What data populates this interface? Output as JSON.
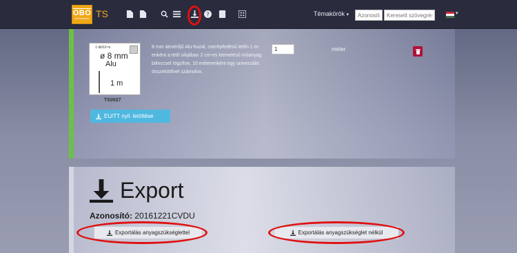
{
  "navbar": {
    "logo_text": "OBO",
    "logo_sub": "BETTERMANN",
    "brand": "TS",
    "topics_label": "Témakörök",
    "id_placeholder": "Azonosító",
    "search_placeholder": "Keresett szövegrész",
    "icons": [
      "file-icon",
      "file-export-icon",
      "search-icon",
      "list-icon",
      "download-icon",
      "help-icon",
      "book-icon",
      "calculator-icon"
    ]
  },
  "product": {
    "card_tiny": "1 db/10 m",
    "card_diameter": "ø 8 mm",
    "card_material": "Alu",
    "card_length": "1 m",
    "code": "TS0027",
    "description": "8 mm átmérőjű Alu-huzal, cserépfedésű tetőn 1 m-enként a tető síkjában 2 cm-es kiemelésű műanyag bilinccsel rögzítve, 10 méterenként egy univerzális összekötővel számolva.",
    "quantity": "1",
    "unit": "méter",
    "eu_button": "EU/TT nyil. letöltése"
  },
  "export": {
    "title": "Export",
    "id_label": "Azonosító:",
    "id_value": "20161221CVDU",
    "with_button": "Exportálás anyagszükséglettel",
    "without_button": "Exportálás anyagszükséglet nélkül"
  },
  "colors": {
    "navbar": "#2a2c3e",
    "accent": "#f0a818",
    "green_bar": "#6cc04a",
    "info_button": "#4fb8e0",
    "danger": "#b0103a",
    "highlight": "#e01010"
  }
}
